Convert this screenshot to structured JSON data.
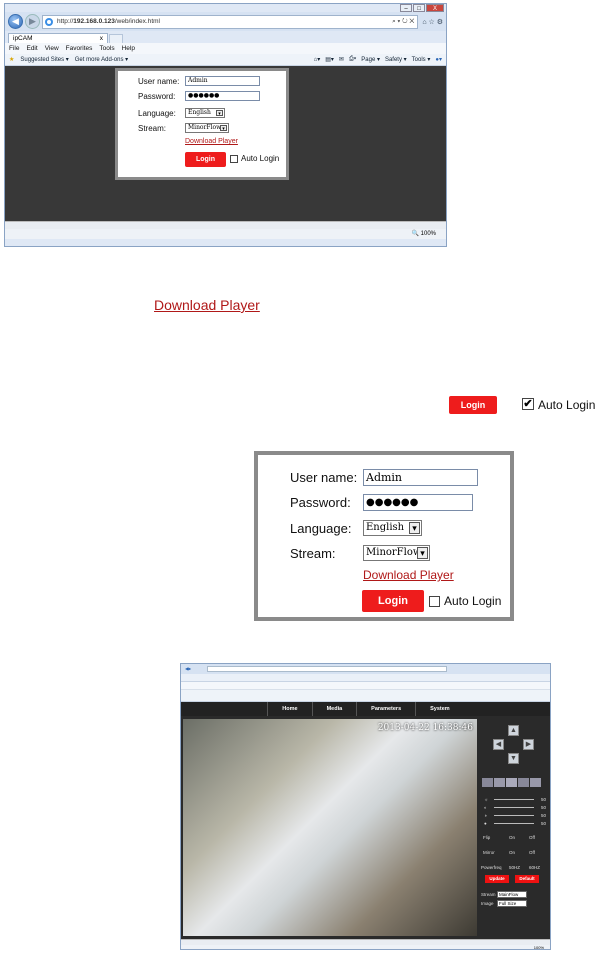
{
  "browser": {
    "url_prefix": "http://",
    "url_host": "192.168.0.123",
    "url_path": "/web/index.html",
    "tab_title": "ipCAM",
    "tab_close": "x",
    "menu": [
      "File",
      "Edit",
      "View",
      "Favorites",
      "Tools",
      "Help"
    ],
    "fav_suggested": "Suggested Sites ▾",
    "fav_addons": "Get more Add-ons ▾",
    "cmd_page": "Page ▾",
    "cmd_safety": "Safety ▾",
    "cmd_tools": "Tools ▾",
    "zoom": "100%",
    "window_controls": [
      "–",
      "□",
      "X"
    ]
  },
  "login": {
    "username_label": "User name:",
    "username_value": "Admin",
    "password_label": "Password:",
    "password_value": "●●●●●●",
    "language_label": "Language:",
    "language_value": "English",
    "stream_label": "Stream:",
    "stream_value": "MinorFlow",
    "download_player": "Download Player",
    "login_button": "Login",
    "auto_login": "Auto Login",
    "dropdown_arrow": "▾"
  },
  "callouts": {
    "download_player": "Download Player",
    "login_button": "Login",
    "auto_login": "Auto Login",
    "auto_login_checked": true
  },
  "camera": {
    "nav": [
      "Home",
      "Media",
      "Parameters",
      "System"
    ],
    "timestamp": "2013-04-22 16:38:46",
    "panel_flip": "Flip",
    "panel_mirror": "Mirror",
    "panel_powerfreq": "Powerfreq",
    "on": "On",
    "off": "Off",
    "hz50": "50HZ",
    "hz60": "60HZ",
    "update_button": "Update",
    "default_button": "Default",
    "slider_values": [
      "50",
      "50",
      "50",
      "50"
    ],
    "stream_label": "Stream",
    "stream_value": "MainFlow",
    "image_label": "Image",
    "image_value": "Full Size",
    "zoom": "100%"
  },
  "colors": {
    "login_red": "#ee1c1c",
    "link_red": "#b01818",
    "content_bg": "#383838"
  }
}
